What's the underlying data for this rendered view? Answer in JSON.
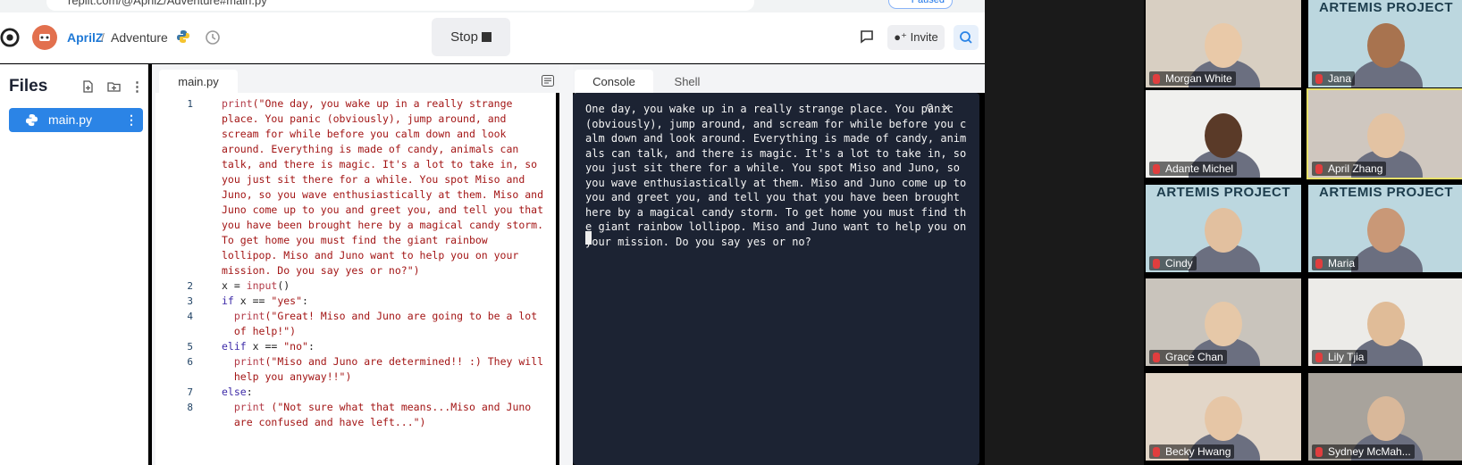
{
  "browser": {
    "url": "replit.com/@AprilZ/Adventure#main.py",
    "paused_label": "Paused"
  },
  "header": {
    "username": "AprilZ",
    "separator": "/",
    "project": "Adventure",
    "stop_label": "Stop",
    "invite_label": "Invite"
  },
  "files": {
    "title": "Files",
    "items": [
      {
        "name": "main.py"
      }
    ]
  },
  "editor": {
    "tab": "main.py",
    "lines": [
      {
        "n": "1",
        "parts": [
          [
            "fn",
            "print"
          ],
          [
            "str",
            "(\"One day, you wake up in a really strange"
          ]
        ]
      },
      {
        "n": "",
        "parts": [
          [
            "str",
            "place. You panic (obviously), jump around, and"
          ]
        ]
      },
      {
        "n": "",
        "parts": [
          [
            "str",
            "scream for while before you calm down and look"
          ]
        ]
      },
      {
        "n": "",
        "parts": [
          [
            "str",
            "around. Everything is made of candy, animals can"
          ]
        ]
      },
      {
        "n": "",
        "parts": [
          [
            "str",
            "talk, and there is magic. It's a lot to take in, so"
          ]
        ]
      },
      {
        "n": "",
        "parts": [
          [
            "str",
            "you just sit there for a while. You spot Miso and"
          ]
        ]
      },
      {
        "n": "",
        "parts": [
          [
            "str",
            "Juno, so you wave enthusiastically at them. Miso and"
          ]
        ]
      },
      {
        "n": "",
        "parts": [
          [
            "str",
            "Juno come up to you and greet you, and tell you that"
          ]
        ]
      },
      {
        "n": "",
        "parts": [
          [
            "str",
            "you have been brought here by a magical candy storm."
          ]
        ]
      },
      {
        "n": "",
        "parts": [
          [
            "str",
            "To get home you must find the giant rainbow"
          ]
        ]
      },
      {
        "n": "",
        "parts": [
          [
            "str",
            "lollipop. Miso and Juno want to help you on your"
          ]
        ]
      },
      {
        "n": "",
        "parts": [
          [
            "str",
            "mission. Do you say yes or no?\")"
          ]
        ]
      },
      {
        "n": "2",
        "parts": [
          [
            "plain",
            "x = "
          ],
          [
            "fn",
            "input"
          ],
          [
            "plain",
            "()"
          ]
        ]
      },
      {
        "n": "3",
        "parts": [
          [
            "kw",
            "if"
          ],
          [
            "plain",
            " x == "
          ],
          [
            "str",
            "\"yes\""
          ],
          [
            "plain",
            ":"
          ]
        ]
      },
      {
        "n": "4",
        "parts": [
          [
            "plain",
            "  "
          ],
          [
            "fn",
            "print"
          ],
          [
            "str",
            "(\"Great! Miso and Juno are going to be a lot"
          ]
        ]
      },
      {
        "n": "",
        "parts": [
          [
            "str",
            "  of help!\")"
          ]
        ]
      },
      {
        "n": "5",
        "parts": [
          [
            "kw",
            "elif"
          ],
          [
            "plain",
            " x == "
          ],
          [
            "str",
            "\"no\""
          ],
          [
            "plain",
            ":"
          ]
        ]
      },
      {
        "n": "6",
        "parts": [
          [
            "plain",
            "  "
          ],
          [
            "fn",
            "print"
          ],
          [
            "str",
            "(\"Miso and Juno are determined!! :) They will"
          ]
        ]
      },
      {
        "n": "",
        "parts": [
          [
            "str",
            "  help you anyway!!\")"
          ]
        ]
      },
      {
        "n": "7",
        "parts": [
          [
            "kw",
            "else"
          ],
          [
            "plain",
            ":"
          ]
        ]
      },
      {
        "n": "8",
        "parts": [
          [
            "plain",
            "  "
          ],
          [
            "fn",
            "print"
          ],
          [
            "plain",
            " "
          ],
          [
            "str",
            "(\"Not sure what that means...Miso and Juno"
          ]
        ]
      },
      {
        "n": "",
        "parts": [
          [
            "str",
            "  are confused and have left...\")"
          ]
        ]
      }
    ]
  },
  "console": {
    "tab_console": "Console",
    "tab_shell": "Shell",
    "output": "One day, you wake up in a really strange place. You panic (obviously), jump around, and scream for while before you calm down and look around. Everything is made of candy, animals can talk, and there is magic. It's a lot to take in, so you just sit there for a while. You spot Miso and Juno, so you wave enthusiastically at them. Miso and Juno come up to you and greet you, and tell you that you have been brought here by a magical candy storm. To get home you must find the giant rainbow lollipop. Miso and Juno want to help you on your mission. Do you say yes or no?"
  },
  "participants": [
    {
      "name": "Morgan White",
      "bg": "#d8cfc2",
      "skin": "#e9c9a8",
      "banner": ""
    },
    {
      "name": "Jana",
      "bg": "#bcd7df",
      "skin": "#a8734f",
      "banner": "ARTEMIS PROJECT"
    },
    {
      "name": "Adante Michel",
      "bg": "#f0f0ee",
      "skin": "#5a3a28",
      "banner": ""
    },
    {
      "name": "April Zhang",
      "bg": "#cfc7bf",
      "skin": "#e3c3a3",
      "banner": ""
    },
    {
      "name": "Cindy",
      "bg": "#bcd7df",
      "skin": "#e2c09f",
      "banner": "ARTEMIS PROJECT"
    },
    {
      "name": "Maria",
      "bg": "#bcd7df",
      "skin": "#c99877",
      "banner": "ARTEMIS PROJECT"
    },
    {
      "name": "Grace Chan",
      "bg": "#c9c4bc",
      "skin": "#e6c8a8",
      "banner": ""
    },
    {
      "name": "Lily Tjia",
      "bg": "#ecebe8",
      "skin": "#e0bc98",
      "banner": ""
    },
    {
      "name": "Becky Hwang",
      "bg": "#e2d6c8",
      "skin": "#e6c6a6",
      "banner": ""
    },
    {
      "name": "Sydney McMah...",
      "bg": "#a8a39c",
      "skin": "#d9b89a",
      "banner": ""
    }
  ],
  "colors": {
    "accent": "#2b84e6",
    "console_bg": "#1c2333",
    "active_speaker": "#e8e16a"
  }
}
